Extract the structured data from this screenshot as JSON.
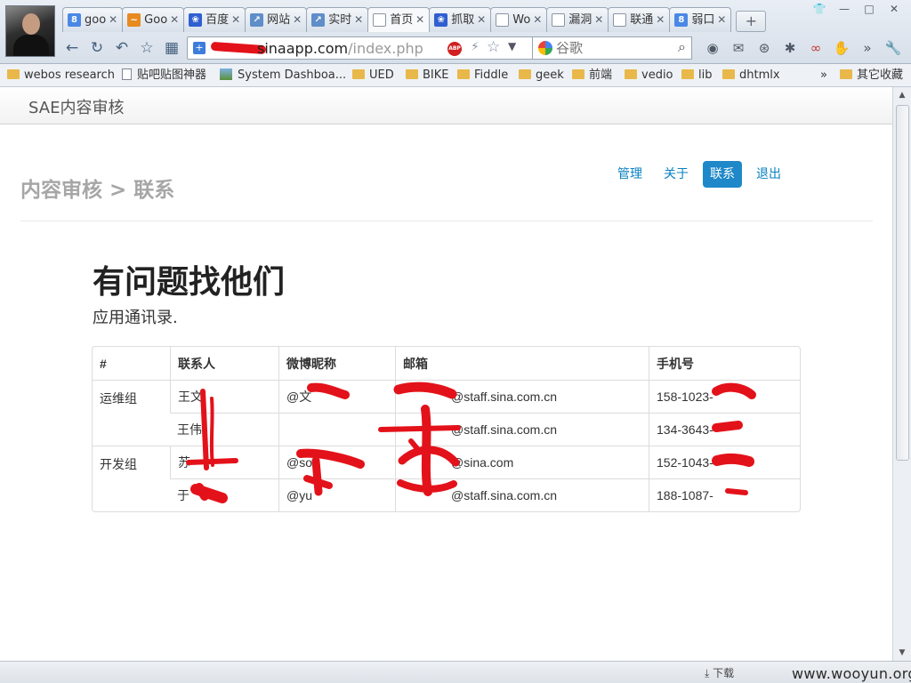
{
  "browser": {
    "tabs": [
      {
        "label": "goo",
        "icon": "google-icon",
        "fav": "g",
        "glyph": "8"
      },
      {
        "label": "Goo",
        "icon": "analytics-icon",
        "fav": "orange",
        "glyph": "~"
      },
      {
        "label": "百度",
        "icon": "baidu-paw-icon",
        "fav": "paw",
        "glyph": "❀"
      },
      {
        "label": "网站",
        "icon": "chart-icon",
        "fav": "chart",
        "glyph": "↗"
      },
      {
        "label": "实时",
        "icon": "chart-icon",
        "fav": "chart",
        "glyph": "↗"
      },
      {
        "label": "首页",
        "icon": "page-icon",
        "fav": "doc",
        "glyph": "",
        "active": true
      },
      {
        "label": "抓取",
        "icon": "baidu-paw-icon",
        "fav": "paw",
        "glyph": "❀"
      },
      {
        "label": "Wo",
        "icon": "page-icon",
        "fav": "doc",
        "glyph": ""
      },
      {
        "label": "漏洞",
        "icon": "page-icon",
        "fav": "doc",
        "glyph": ""
      },
      {
        "label": "联通",
        "icon": "page-icon",
        "fav": "doc",
        "glyph": ""
      },
      {
        "label": "弱口",
        "icon": "google-icon",
        "fav": "g",
        "glyph": "8"
      }
    ],
    "tab_close": "✕",
    "new_tab": "+",
    "address": {
      "host": "sinaapp.com",
      "path": "/index.php"
    },
    "search_placeholder": "谷歌",
    "bookmarks": [
      {
        "label": "webos research",
        "kind": "folder"
      },
      {
        "label": "贴吧贴图神器",
        "kind": "page"
      },
      {
        "label": "System Dashboa...",
        "kind": "img"
      },
      {
        "label": "UED",
        "kind": "folder"
      },
      {
        "label": "BIKE",
        "kind": "folder"
      },
      {
        "label": "Fiddle",
        "kind": "folder"
      },
      {
        "label": "geek",
        "kind": "folder"
      },
      {
        "label": "前端",
        "kind": "folder"
      },
      {
        "label": "vedio",
        "kind": "folder"
      },
      {
        "label": "lib",
        "kind": "folder"
      },
      {
        "label": "dhtmlx",
        "kind": "folder"
      }
    ],
    "bookmarks_more": "»",
    "other_bookmarks": "其它收藏",
    "status_download": "下载",
    "watermark": "www.wooyun.org"
  },
  "app": {
    "brand": "SAE内容审核",
    "breadcrumb": "内容审核 > 联系",
    "nav": [
      {
        "label": "管理",
        "active": false
      },
      {
        "label": "关于",
        "active": false
      },
      {
        "label": "联系",
        "active": true
      },
      {
        "label": "退出",
        "active": false
      }
    ],
    "title": "有问题找他们",
    "subtitle": "应用通讯录.",
    "table": {
      "headers": [
        "#",
        "联系人",
        "微博昵称",
        "邮箱",
        "手机号"
      ],
      "groups": [
        {
          "name": "运维组",
          "rows": [
            {
              "contact": "王文",
              "weibo": "@文",
              "email": "@staff.sina.com.cn",
              "phone": "158-1023-"
            },
            {
              "contact": "王伟",
              "weibo": "",
              "email": "@staff.sina.com.cn",
              "phone": "134-3643-"
            }
          ]
        },
        {
          "name": "开发组",
          "rows": [
            {
              "contact": "苏",
              "weibo": "@so",
              "email": "@sina.com",
              "phone": "152-1043-"
            },
            {
              "contact": "于",
              "weibo": "@yu",
              "email": "@staff.sina.com.cn",
              "phone": "188-1087-"
            }
          ]
        }
      ]
    }
  },
  "colors": {
    "accent": "#1e88c9",
    "redaction": "#e3121a"
  }
}
